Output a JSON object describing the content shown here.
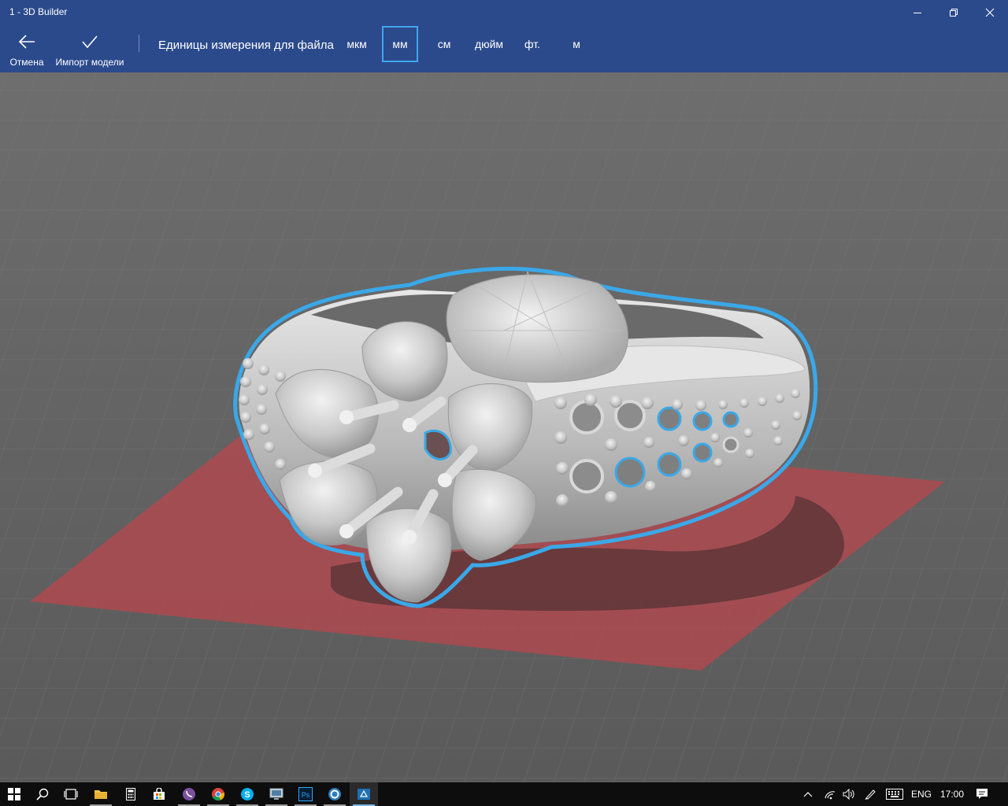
{
  "window": {
    "title": "1 - 3D Builder"
  },
  "toolbar": {
    "cancel_label": "Отмена",
    "import_label": "Импорт модели",
    "units_label": "Единицы измерения для файла",
    "units": [
      {
        "label": "мкм",
        "selected": false
      },
      {
        "label": "мм",
        "selected": true
      },
      {
        "label": "см",
        "selected": false
      },
      {
        "label": "дюйм",
        "selected": false
      },
      {
        "label": "фт.",
        "selected": false
      },
      {
        "label": "м",
        "selected": false
      }
    ]
  },
  "taskbar": {
    "apps": [
      {
        "name": "file-explorer-icon",
        "running": true
      },
      {
        "name": "calculator-icon",
        "running": false
      },
      {
        "name": "store-icon",
        "running": false
      },
      {
        "name": "viber-icon",
        "running": true
      },
      {
        "name": "chrome-icon",
        "running": true
      },
      {
        "name": "skype-icon",
        "running": true
      },
      {
        "name": "remote-desktop-icon",
        "running": true
      },
      {
        "name": "photoshop-icon",
        "running": true
      },
      {
        "name": "app-icon",
        "running": true
      },
      {
        "name": "3d-builder-icon",
        "running": true,
        "active": true
      }
    ],
    "language": "ENG",
    "time": "17:00"
  },
  "colors": {
    "accent": "#2b4a8c",
    "selection": "#41a5f0",
    "build_plate": "#b5484e",
    "model": "#d4d4d4"
  }
}
